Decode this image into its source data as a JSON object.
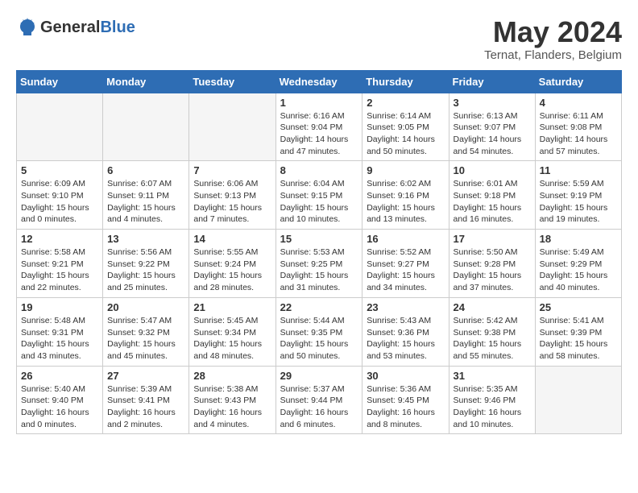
{
  "header": {
    "logo_general": "General",
    "logo_blue": "Blue",
    "month_year": "May 2024",
    "location": "Ternat, Flanders, Belgium"
  },
  "weekdays": [
    "Sunday",
    "Monday",
    "Tuesday",
    "Wednesday",
    "Thursday",
    "Friday",
    "Saturday"
  ],
  "weeks": [
    [
      {
        "day": "",
        "sunrise": "",
        "sunset": "",
        "daylight": "",
        "empty": true
      },
      {
        "day": "",
        "sunrise": "",
        "sunset": "",
        "daylight": "",
        "empty": true
      },
      {
        "day": "",
        "sunrise": "",
        "sunset": "",
        "daylight": "",
        "empty": true
      },
      {
        "day": "1",
        "sunrise": "Sunrise: 6:16 AM",
        "sunset": "Sunset: 9:04 PM",
        "daylight": "Daylight: 14 hours and 47 minutes."
      },
      {
        "day": "2",
        "sunrise": "Sunrise: 6:14 AM",
        "sunset": "Sunset: 9:05 PM",
        "daylight": "Daylight: 14 hours and 50 minutes."
      },
      {
        "day": "3",
        "sunrise": "Sunrise: 6:13 AM",
        "sunset": "Sunset: 9:07 PM",
        "daylight": "Daylight: 14 hours and 54 minutes."
      },
      {
        "day": "4",
        "sunrise": "Sunrise: 6:11 AM",
        "sunset": "Sunset: 9:08 PM",
        "daylight": "Daylight: 14 hours and 57 minutes."
      }
    ],
    [
      {
        "day": "5",
        "sunrise": "Sunrise: 6:09 AM",
        "sunset": "Sunset: 9:10 PM",
        "daylight": "Daylight: 15 hours and 0 minutes."
      },
      {
        "day": "6",
        "sunrise": "Sunrise: 6:07 AM",
        "sunset": "Sunset: 9:11 PM",
        "daylight": "Daylight: 15 hours and 4 minutes."
      },
      {
        "day": "7",
        "sunrise": "Sunrise: 6:06 AM",
        "sunset": "Sunset: 9:13 PM",
        "daylight": "Daylight: 15 hours and 7 minutes."
      },
      {
        "day": "8",
        "sunrise": "Sunrise: 6:04 AM",
        "sunset": "Sunset: 9:15 PM",
        "daylight": "Daylight: 15 hours and 10 minutes."
      },
      {
        "day": "9",
        "sunrise": "Sunrise: 6:02 AM",
        "sunset": "Sunset: 9:16 PM",
        "daylight": "Daylight: 15 hours and 13 minutes."
      },
      {
        "day": "10",
        "sunrise": "Sunrise: 6:01 AM",
        "sunset": "Sunset: 9:18 PM",
        "daylight": "Daylight: 15 hours and 16 minutes."
      },
      {
        "day": "11",
        "sunrise": "Sunrise: 5:59 AM",
        "sunset": "Sunset: 9:19 PM",
        "daylight": "Daylight: 15 hours and 19 minutes."
      }
    ],
    [
      {
        "day": "12",
        "sunrise": "Sunrise: 5:58 AM",
        "sunset": "Sunset: 9:21 PM",
        "daylight": "Daylight: 15 hours and 22 minutes."
      },
      {
        "day": "13",
        "sunrise": "Sunrise: 5:56 AM",
        "sunset": "Sunset: 9:22 PM",
        "daylight": "Daylight: 15 hours and 25 minutes."
      },
      {
        "day": "14",
        "sunrise": "Sunrise: 5:55 AM",
        "sunset": "Sunset: 9:24 PM",
        "daylight": "Daylight: 15 hours and 28 minutes."
      },
      {
        "day": "15",
        "sunrise": "Sunrise: 5:53 AM",
        "sunset": "Sunset: 9:25 PM",
        "daylight": "Daylight: 15 hours and 31 minutes."
      },
      {
        "day": "16",
        "sunrise": "Sunrise: 5:52 AM",
        "sunset": "Sunset: 9:27 PM",
        "daylight": "Daylight: 15 hours and 34 minutes."
      },
      {
        "day": "17",
        "sunrise": "Sunrise: 5:50 AM",
        "sunset": "Sunset: 9:28 PM",
        "daylight": "Daylight: 15 hours and 37 minutes."
      },
      {
        "day": "18",
        "sunrise": "Sunrise: 5:49 AM",
        "sunset": "Sunset: 9:29 PM",
        "daylight": "Daylight: 15 hours and 40 minutes."
      }
    ],
    [
      {
        "day": "19",
        "sunrise": "Sunrise: 5:48 AM",
        "sunset": "Sunset: 9:31 PM",
        "daylight": "Daylight: 15 hours and 43 minutes."
      },
      {
        "day": "20",
        "sunrise": "Sunrise: 5:47 AM",
        "sunset": "Sunset: 9:32 PM",
        "daylight": "Daylight: 15 hours and 45 minutes."
      },
      {
        "day": "21",
        "sunrise": "Sunrise: 5:45 AM",
        "sunset": "Sunset: 9:34 PM",
        "daylight": "Daylight: 15 hours and 48 minutes."
      },
      {
        "day": "22",
        "sunrise": "Sunrise: 5:44 AM",
        "sunset": "Sunset: 9:35 PM",
        "daylight": "Daylight: 15 hours and 50 minutes."
      },
      {
        "day": "23",
        "sunrise": "Sunrise: 5:43 AM",
        "sunset": "Sunset: 9:36 PM",
        "daylight": "Daylight: 15 hours and 53 minutes."
      },
      {
        "day": "24",
        "sunrise": "Sunrise: 5:42 AM",
        "sunset": "Sunset: 9:38 PM",
        "daylight": "Daylight: 15 hours and 55 minutes."
      },
      {
        "day": "25",
        "sunrise": "Sunrise: 5:41 AM",
        "sunset": "Sunset: 9:39 PM",
        "daylight": "Daylight: 15 hours and 58 minutes."
      }
    ],
    [
      {
        "day": "26",
        "sunrise": "Sunrise: 5:40 AM",
        "sunset": "Sunset: 9:40 PM",
        "daylight": "Daylight: 16 hours and 0 minutes."
      },
      {
        "day": "27",
        "sunrise": "Sunrise: 5:39 AM",
        "sunset": "Sunset: 9:41 PM",
        "daylight": "Daylight: 16 hours and 2 minutes."
      },
      {
        "day": "28",
        "sunrise": "Sunrise: 5:38 AM",
        "sunset": "Sunset: 9:43 PM",
        "daylight": "Daylight: 16 hours and 4 minutes."
      },
      {
        "day": "29",
        "sunrise": "Sunrise: 5:37 AM",
        "sunset": "Sunset: 9:44 PM",
        "daylight": "Daylight: 16 hours and 6 minutes."
      },
      {
        "day": "30",
        "sunrise": "Sunrise: 5:36 AM",
        "sunset": "Sunset: 9:45 PM",
        "daylight": "Daylight: 16 hours and 8 minutes."
      },
      {
        "day": "31",
        "sunrise": "Sunrise: 5:35 AM",
        "sunset": "Sunset: 9:46 PM",
        "daylight": "Daylight: 16 hours and 10 minutes."
      },
      {
        "day": "",
        "sunrise": "",
        "sunset": "",
        "daylight": "",
        "empty": true
      }
    ]
  ]
}
